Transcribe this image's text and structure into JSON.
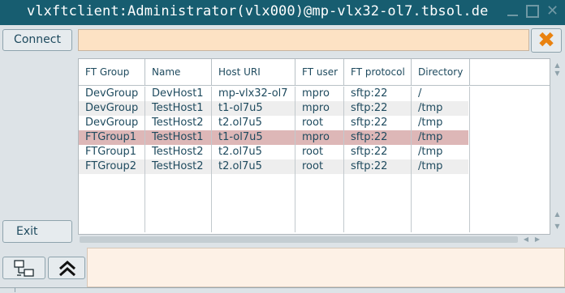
{
  "window": {
    "title": "vlxftclient:Administrator(vlx000)@mp-vlx32-ol7.tbsol.de"
  },
  "sidebar": {
    "connect_label": "Connect",
    "exit_label": "Exit"
  },
  "table": {
    "columns": [
      "FT Group",
      "Name",
      "Host URI",
      "FT user",
      "FT protocol",
      "Directory"
    ],
    "rows": [
      [
        "DevGroup",
        "DevHost1",
        "mp-vlx32-ol7",
        "mpro",
        "sftp:22",
        "/"
      ],
      [
        "DevGroup",
        "TestHost1",
        "t1-ol7u5",
        "mpro",
        "sftp:22",
        "/tmp"
      ],
      [
        "DevGroup",
        "TestHost2",
        "t2.ol7u5",
        "root",
        "sftp:22",
        "/tmp"
      ],
      [
        "FTGroup1",
        "TestHost1",
        "t1-ol7u5",
        "mpro",
        "sftp:22",
        "/tmp"
      ],
      [
        "FTGroup1",
        "TestHost2",
        "t2.ol7u5",
        "root",
        "sftp:22",
        "/tmp"
      ],
      [
        "FTGroup2",
        "TestHost2",
        "t2.ol7u5",
        "root",
        "sftp:22",
        "/tmp"
      ]
    ],
    "selected_row": 3
  },
  "icons": {
    "clear": "close-x-icon",
    "network": "network-icon",
    "collapse": "double-chevron-up-icon"
  },
  "colors": {
    "titlebar": "#175d70",
    "accent_orange": "#e98210",
    "selected_row": "#ddb7b7",
    "input_bg": "#fde2c4"
  }
}
